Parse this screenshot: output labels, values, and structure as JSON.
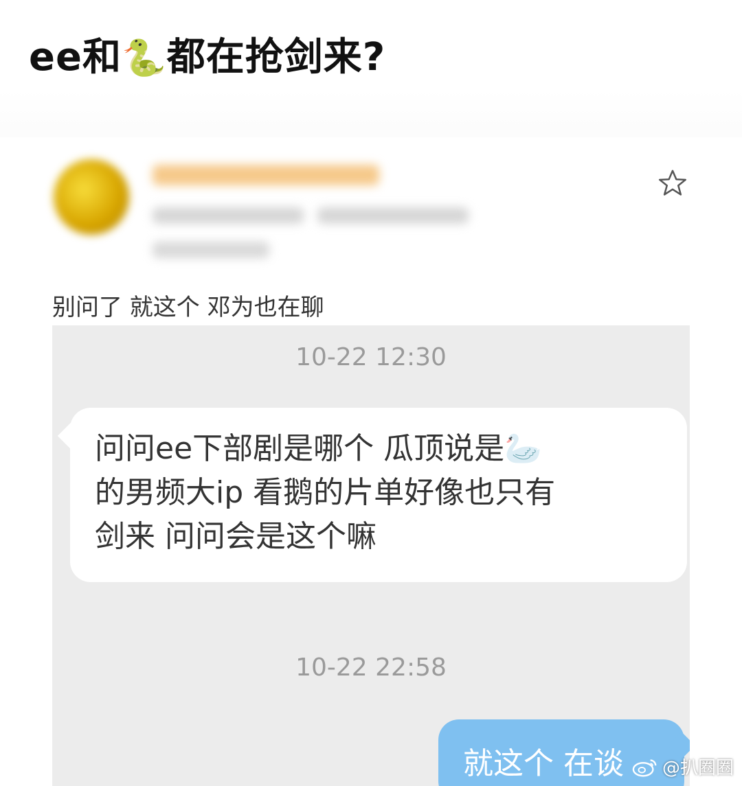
{
  "headline": {
    "prefix": "ee和",
    "emoji": "🐍",
    "suffix": "都在抢剑来?"
  },
  "post": {
    "text": "别问了 就这个 邓为也在聊",
    "favorite_icon": "star-outline-icon"
  },
  "chat": {
    "timestamps": [
      "10-22 12:30",
      "10-22 22:58"
    ],
    "received_message": {
      "line1": "问问ee下部剧是哪个 瓜顶说是🦢",
      "line2": "的男频大ip 看鹅的片单好像也只有",
      "line3": "剑来 问问会是这个嘛"
    },
    "sent_message": "就这个 在谈"
  },
  "watermark": {
    "icon": "weibo-icon",
    "text": "@扒圈圈"
  },
  "colors": {
    "chat_background": "#ececec",
    "sent_bubble": "#7fc0f0",
    "received_bubble": "#ffffff"
  }
}
